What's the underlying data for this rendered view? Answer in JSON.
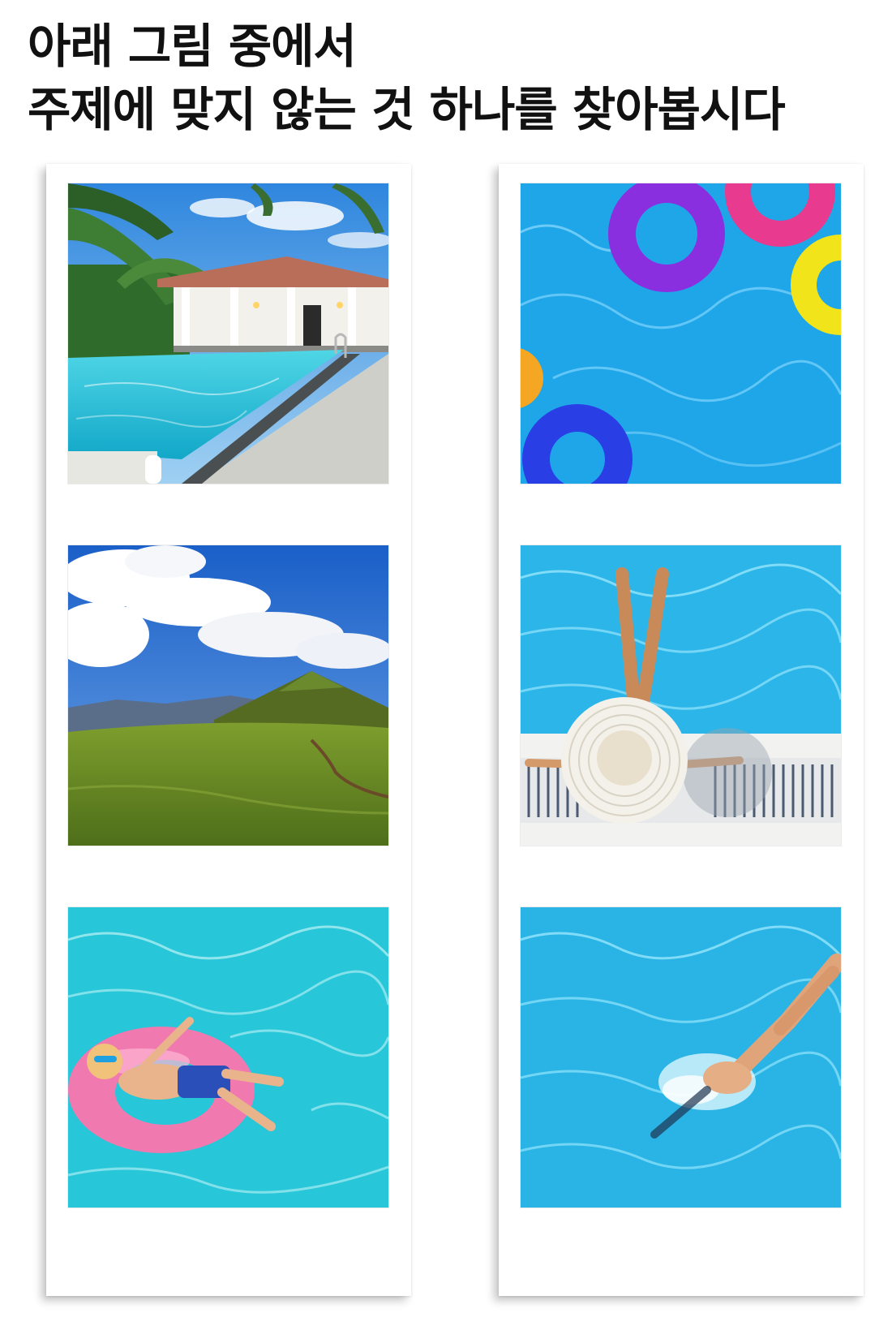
{
  "title": {
    "line1": "아래 그림 중에서",
    "line2": "주제에 맞지 않는 것 하나를 찾아봅시다"
  },
  "photos": {
    "left": [
      {
        "id": "villa-pool",
        "subject": "infinity pool beside a white villa with palm trees"
      },
      {
        "id": "green-hills",
        "subject": "green grassy hills under blue sky with clouds"
      },
      {
        "id": "boy-pink-float",
        "subject": "boy relaxing on a pink swim ring in pool"
      }
    ],
    "right": [
      {
        "id": "pool-floats",
        "subject": "colorful inflatable rings floating on pool water"
      },
      {
        "id": "woman-sunhat",
        "subject": "woman in white sun hat sitting at pool edge"
      },
      {
        "id": "diver",
        "subject": "person diving headfirst into pool"
      }
    ]
  },
  "colors": {
    "pool_blue": "#1fa6e8",
    "pool_turquoise": "#27c6d8",
    "sky_blue": "#2a7fd8",
    "grass_green": "#6d8f2a",
    "ring_purple": "#8a2fe0",
    "ring_pink": "#e83a8e",
    "ring_yellow": "#f2e41a",
    "ring_blue": "#2a3ee6"
  }
}
